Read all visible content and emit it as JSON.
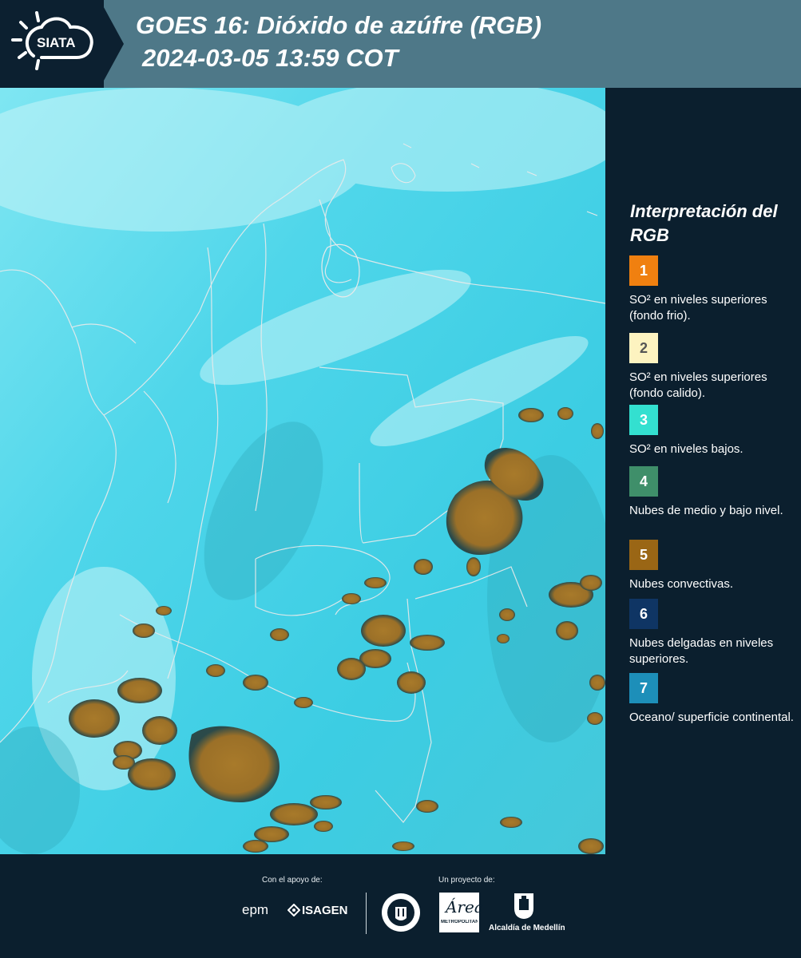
{
  "header": {
    "logo_text": "SIATA",
    "title_line1": "GOES 16: Dióxido de azúfre (RGB)",
    "title_line2": "2024-03-05 13:59 COT"
  },
  "legend": {
    "title": "Interpretación del RGB",
    "items": [
      {
        "number": "1",
        "color": "#f08010",
        "label": "SO² en niveles superiores (fondo frio)."
      },
      {
        "number": "2",
        "color": "#fdf3c0",
        "label": "SO² en niveles superiores (fondo calido)."
      },
      {
        "number": "3",
        "color": "#33e0d0",
        "label": "SO² en niveles bajos."
      },
      {
        "number": "4",
        "color": "#3f8f6a",
        "label": "Nubes de medio y bajo nivel."
      },
      {
        "number": "5",
        "color": "#9a6615",
        "label": "Nubes convectivas."
      },
      {
        "number": "6",
        "color": "#0f3564",
        "label": "Nubes delgadas en niveles superiores."
      },
      {
        "number": "7",
        "color": "#1d8fb9",
        "label": "Oceano/ superficie continental."
      }
    ]
  },
  "footer": {
    "support_label": "Con el apoyo de:",
    "project_label": "Un proyecto de:",
    "sponsors": [
      "epm",
      "ISAGEN"
    ],
    "area_text": "Área",
    "area_subtext": "METROPOLITANA",
    "alcaldia_text": "Alcaldía de Medellín"
  },
  "map": {
    "land_color": "#41d2e6",
    "border_color": "#e6e6e6",
    "cloud_color": "#a77b2a"
  }
}
